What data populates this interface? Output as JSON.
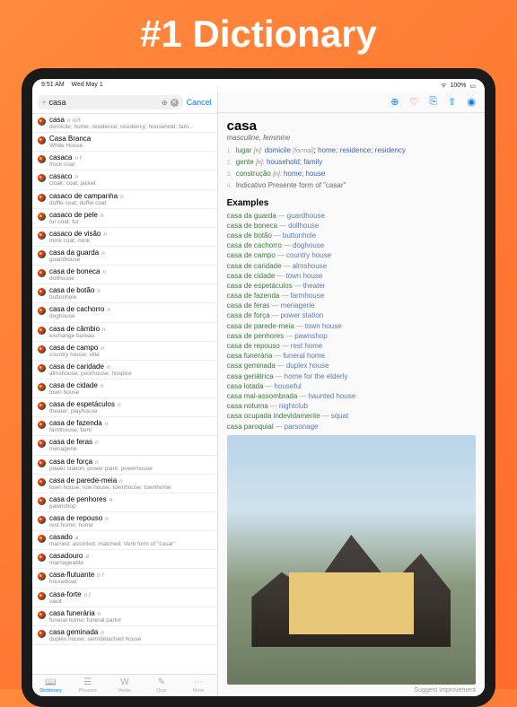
{
  "title": "#1 Dictionary",
  "status": {
    "time": "9:51 AM",
    "date": "Wed May 1",
    "wifi": "wifi",
    "battery": "100%"
  },
  "search": {
    "value": "casa",
    "cancel": "Cancel"
  },
  "list": [
    {
      "word": "casa",
      "pos": "n m/f",
      "def": "domicile; home; residence; residency; household; fam..."
    },
    {
      "word": "Casa Branca",
      "pos": "",
      "def": "White House"
    },
    {
      "word": "casaca",
      "pos": "n f",
      "def": "frock coat"
    },
    {
      "word": "casaco",
      "pos": "n",
      "def": "cloak; coat; jacket"
    },
    {
      "word": "casaco de campanha",
      "pos": "n",
      "def": "duffle coat; duffel coat"
    },
    {
      "word": "casaco de pele",
      "pos": "n",
      "def": "fur coat; fur"
    },
    {
      "word": "casaco de visão",
      "pos": "n",
      "def": "mink coat; mink"
    },
    {
      "word": "casa da guarda",
      "pos": "n",
      "def": "guardhouse"
    },
    {
      "word": "casa de boneca",
      "pos": "n",
      "def": "dollhouse"
    },
    {
      "word": "casa de botão",
      "pos": "n",
      "def": "buttonhole"
    },
    {
      "word": "casa de cachorro",
      "pos": "n",
      "def": "doghouse"
    },
    {
      "word": "casa de câmbio",
      "pos": "n",
      "def": "exchange bureau"
    },
    {
      "word": "casa de campo",
      "pos": "n",
      "def": "country house; villa"
    },
    {
      "word": "casa de caridade",
      "pos": "n",
      "def": "almshouse; poorhouse; hospice"
    },
    {
      "word": "casa de cidade",
      "pos": "n",
      "def": "town house"
    },
    {
      "word": "casa de espetáculos",
      "pos": "n",
      "def": "theater; playhouse"
    },
    {
      "word": "casa de fazenda",
      "pos": "n",
      "def": "farmhouse; farm"
    },
    {
      "word": "casa de feras",
      "pos": "n",
      "def": "menagerie"
    },
    {
      "word": "casa de força",
      "pos": "n",
      "def": "power station; power plant; powerhouse"
    },
    {
      "word": "casa de parede-meia",
      "pos": "n",
      "def": "town house; row house; townhouse; townhome"
    },
    {
      "word": "casa de penhores",
      "pos": "n",
      "def": "pawnshop"
    },
    {
      "word": "casa de repouso",
      "pos": "n",
      "def": "rest home; home"
    },
    {
      "word": "casado",
      "pos": "a",
      "def": "married; assorted; matched; Verb form of \"casar\""
    },
    {
      "word": "casadouro",
      "pos": "a",
      "def": "marriageable"
    },
    {
      "word": "casa-flutuante",
      "pos": "n f",
      "def": "houseboat"
    },
    {
      "word": "casa-forte",
      "pos": "n f",
      "def": "vault"
    },
    {
      "word": "casa funerária",
      "pos": "n",
      "def": "funeral home; funeral parlor"
    },
    {
      "word": "casa geminada",
      "pos": "n",
      "def": "duplex house; semidetached house"
    }
  ],
  "tabs": [
    {
      "icon": "book",
      "label": "Dictionary",
      "active": true
    },
    {
      "icon": "list",
      "label": "Phrases",
      "active": false
    },
    {
      "icon": "verb",
      "label": "Verbs",
      "active": false
    },
    {
      "icon": "quiz",
      "label": "Quiz",
      "active": false
    },
    {
      "icon": "more",
      "label": "More",
      "active": false
    }
  ],
  "detail": {
    "word": "casa",
    "gender": "masculine, feminine",
    "senses": [
      {
        "n": "1.",
        "pt": "lugar",
        "gram": "[n]:",
        "formal": "[formal]",
        "en": "domicile; home; residence; residency"
      },
      {
        "n": "2.",
        "pt": "gente",
        "gram": "[n]:",
        "formal": "",
        "en": "household; family"
      },
      {
        "n": "3.",
        "pt": "construção",
        "gram": "[n]:",
        "formal": "",
        "en": "home; house"
      },
      {
        "n": "4.",
        "pt": "",
        "gram": "",
        "formal": "",
        "en": "Indicativo Presente form of \"casar\""
      }
    ],
    "examples_heading": "Examples",
    "examples": [
      {
        "pt": "casa da guarda",
        "en": "guardhouse"
      },
      {
        "pt": "casa de boneca",
        "en": "dollhouse"
      },
      {
        "pt": "casa de botão",
        "en": "buttonhole"
      },
      {
        "pt": "casa de cachorro",
        "en": "doghouse"
      },
      {
        "pt": "casa de campo",
        "en": "country house"
      },
      {
        "pt": "casa de caridade",
        "en": "almshouse"
      },
      {
        "pt": "casa de cidade",
        "en": "town house"
      },
      {
        "pt": "casa de espetáculos",
        "en": "theater"
      },
      {
        "pt": "casa de fazenda",
        "en": "farmhouse"
      },
      {
        "pt": "casa de feras",
        "en": "menagerie"
      },
      {
        "pt": "casa de força",
        "en": "power station"
      },
      {
        "pt": "casa de parede-meia",
        "en": "town house"
      },
      {
        "pt": "casa de penhores",
        "en": "pawnshop"
      },
      {
        "pt": "casa de repouso",
        "en": "rest home"
      },
      {
        "pt": "casa funerária",
        "en": "funeral home"
      },
      {
        "pt": "casa geminada",
        "en": "duplex house"
      },
      {
        "pt": "casa geriátrica",
        "en": "home for the elderly"
      },
      {
        "pt": "casa lotada",
        "en": "houseful"
      },
      {
        "pt": "casa mal-assombrada",
        "en": "haunted house"
      },
      {
        "pt": "casa noturna",
        "en": "nightclub"
      },
      {
        "pt": "casa ocupada indevidamente",
        "en": "squat"
      },
      {
        "pt": "casa paroquial",
        "en": "parsonage"
      }
    ],
    "suggest": "Suggest Improvement"
  }
}
